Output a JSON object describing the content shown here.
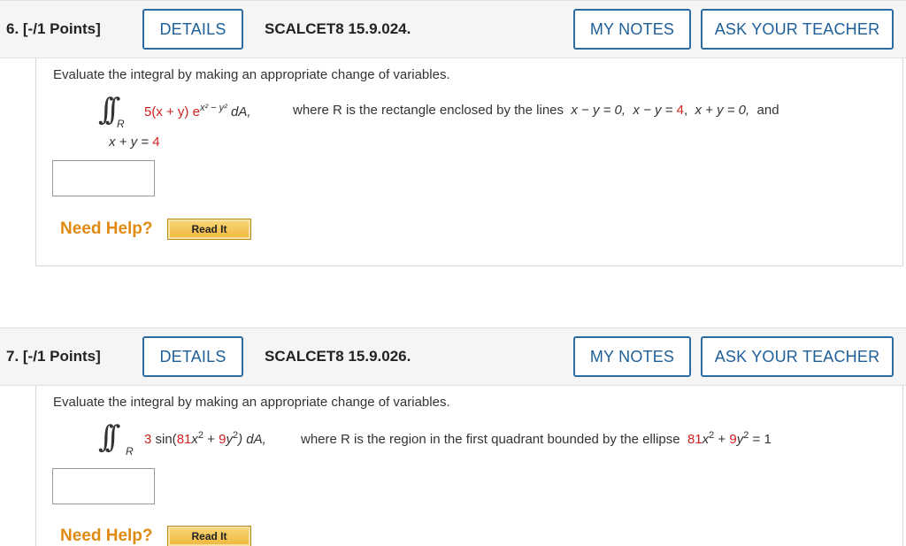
{
  "questions": [
    {
      "number": "6. [-/1 Points]",
      "details_label": "DETAILS",
      "code": "SCALCET8 15.9.024.",
      "notes_label": "MY NOTES",
      "teacher_label": "ASK YOUR TEACHER",
      "instruction": "Evaluate the integral by making an appropriate change of variables.",
      "integrand": "5(x + y) e",
      "exponent": "x² − y²",
      "differential": "dA,",
      "region_sub": "R",
      "region_text": "where R is the rectangle enclosed by the lines",
      "line1": "x − y = 0,",
      "line2_prefix": "x − y = ",
      "line2_value": "4",
      "line2_suffix": ",",
      "line3": "x + y = 0,",
      "and_word": "and",
      "line4_prefix": "x + y = ",
      "line4_value": "4",
      "answer_value": "",
      "help_label": "Need Help?",
      "read_label": "Read It"
    },
    {
      "number": "7. [-/1 Points]",
      "details_label": "DETAILS",
      "code": "SCALCET8 15.9.026.",
      "notes_label": "MY NOTES",
      "teacher_label": "ASK YOUR TEACHER",
      "instruction": "Evaluate the integral by making an appropriate change of variables.",
      "integrand_coef": "3",
      "integrand_fn": " sin(",
      "coef_a": "81",
      "var_x": "x",
      "plus": " + ",
      "coef_b": "9",
      "var_y": "y",
      "close_diff": ") dA,",
      "region_sub": "R",
      "region_text": "where R is the region in the first quadrant bounded by the ellipse",
      "ellipse_a": "81",
      "ellipse_b": "9",
      "ellipse_rhs": " = 1",
      "answer_value": "",
      "help_label": "Need Help?",
      "read_label": "Read It"
    }
  ],
  "colors": {
    "accent": "#1e5f99",
    "help": "#e08a12",
    "red": "#d12020",
    "header_bg": "#f5f5f5"
  }
}
